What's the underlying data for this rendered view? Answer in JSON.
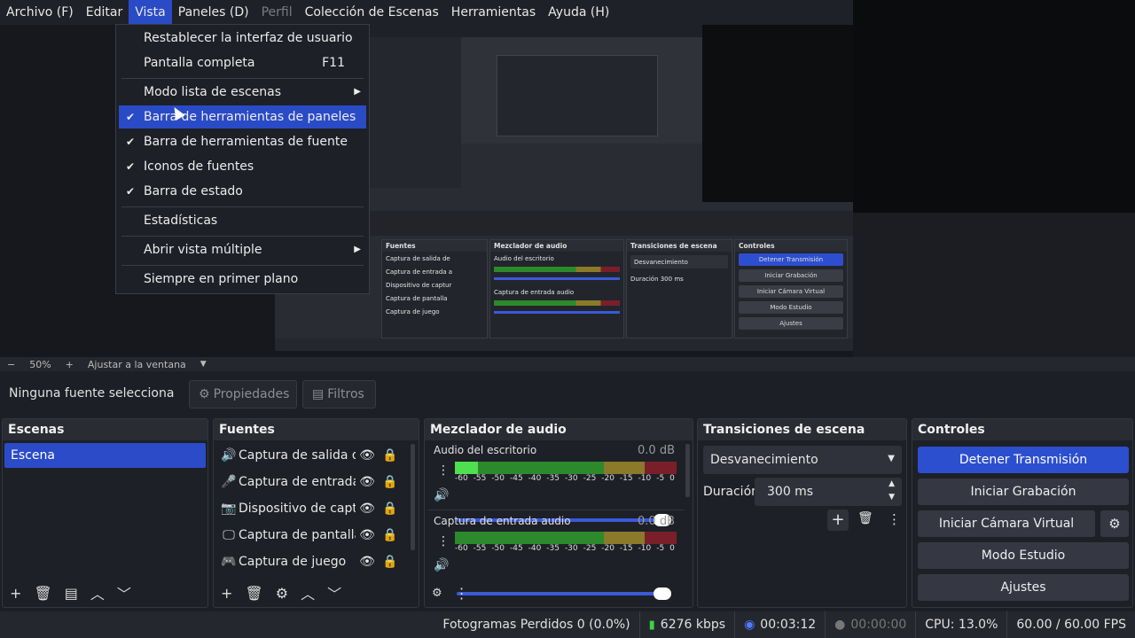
{
  "menubar": {
    "items": [
      "Archivo (F)",
      "Editar",
      "Vista",
      "Paneles (D)",
      "Perfil",
      "Colección de Escenas",
      "Herramientas",
      "Ayuda (H)"
    ]
  },
  "view_menu": {
    "items": [
      {
        "label": "Restablecer la interfaz de usuario",
        "shortcut": "",
        "checked": false,
        "submenu": false
      },
      {
        "label": "Pantalla completa",
        "shortcut": "F11",
        "checked": false,
        "submenu": false
      },
      {
        "label": "Modo lista de escenas",
        "shortcut": "",
        "checked": false,
        "submenu": true
      },
      {
        "label": "Barra de herramientas de paneles",
        "shortcut": "",
        "checked": true,
        "submenu": false
      },
      {
        "label": "Barra de herramientas de fuente",
        "shortcut": "",
        "checked": true,
        "submenu": false
      },
      {
        "label": "Iconos de fuentes",
        "shortcut": "",
        "checked": true,
        "submenu": false
      },
      {
        "label": "Barra de estado",
        "shortcut": "",
        "checked": true,
        "submenu": false
      },
      {
        "label": "Estadísticas",
        "shortcut": "",
        "checked": false,
        "submenu": false
      },
      {
        "label": "Abrir vista múltiple",
        "shortcut": "",
        "checked": false,
        "submenu": true
      },
      {
        "label": "Siempre en primer plano",
        "shortcut": "",
        "checked": false,
        "submenu": false
      }
    ]
  },
  "zoom": {
    "minus": "−",
    "value": "50%",
    "plus": "+",
    "fit": "Ajustar a la ventana"
  },
  "source_toolbar": {
    "status": "Ninguna fuente selecciona",
    "properties": "Propiedades",
    "filters": "Filtros"
  },
  "scenes": {
    "title": "Escenas",
    "items": [
      "Escena"
    ]
  },
  "sources": {
    "title": "Fuentes",
    "items": [
      {
        "icon": "speaker-icon",
        "label": "Captura de salida de a"
      },
      {
        "icon": "microphone-icon",
        "label": "Captura de entrada au"
      },
      {
        "icon": "camera-icon",
        "label": "Dispositivo de captura"
      },
      {
        "icon": "monitor-icon",
        "label": "Captura de pantalla"
      },
      {
        "icon": "gamepad-icon",
        "label": "Captura de juego"
      }
    ]
  },
  "mixer": {
    "title": "Mezclador de audio",
    "channels": [
      {
        "name": "Audio del escritorio",
        "db": "0.0 dB"
      },
      {
        "name": "Captura de entrada audio",
        "db": "0.0 dB"
      }
    ],
    "scale": [
      "-60",
      "-55",
      "-50",
      "-45",
      "-40",
      "-35",
      "-30",
      "-25",
      "-20",
      "-15",
      "-10",
      "-5",
      "0"
    ]
  },
  "transitions": {
    "title": "Transiciones de escena",
    "selected": "Desvanecimiento",
    "duration_label": "Duración",
    "duration_value": "300 ms"
  },
  "controls": {
    "title": "Controles",
    "stop_stream": "Detener Transmisión",
    "start_recording": "Iniciar Grabación",
    "virtual_cam": "Iniciar Cámara Virtual",
    "studio_mode": "Modo Estudio",
    "settings": "Ajustes"
  },
  "statusbar": {
    "dropped": "Fotogramas Perdidos 0 (0.0%)",
    "bitrate": "6276 kbps",
    "stream_time": "00:03:12",
    "rec_time": "00:00:00",
    "cpu": "CPU: 13.0%",
    "fps": "60.00 / 60.00 FPS"
  },
  "colors": {
    "accent": "#2a4bc6",
    "meter_green": "#2c8a2c",
    "meter_yellow": "#8a7a2a",
    "meter_red": "#7a1f2a"
  }
}
